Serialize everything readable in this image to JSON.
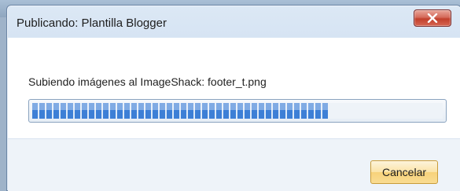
{
  "window": {
    "title": "Publicando: Plantilla Blogger",
    "close_icon": "close-icon"
  },
  "content": {
    "status_text": "Subiendo imágenes al ImageShack: footer_t.png",
    "progress": 0.72
  },
  "buttons": {
    "cancel_label": "Cancelar"
  },
  "colors": {
    "progress_fill": "#3d7fd6",
    "close_button": "#c2402c",
    "dialog_frame": "#c9dbef"
  }
}
